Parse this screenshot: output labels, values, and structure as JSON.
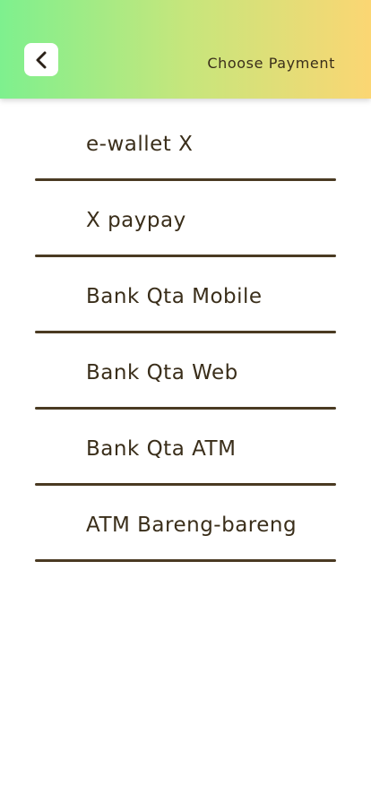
{
  "header": {
    "title": "Choose Payment",
    "back_icon": "chevron-left-icon"
  },
  "colors": {
    "gradient_start": "#7ef08e",
    "gradient_end": "#fbd673",
    "text": "#3a2e1a",
    "divider": "#4a3a22"
  },
  "payment_methods": [
    {
      "label": "e-wallet X"
    },
    {
      "label": "X paypay"
    },
    {
      "label": "Bank Qta Mobile"
    },
    {
      "label": "Bank Qta Web"
    },
    {
      "label": "Bank Qta ATM"
    },
    {
      "label": "ATM Bareng-bareng"
    }
  ]
}
